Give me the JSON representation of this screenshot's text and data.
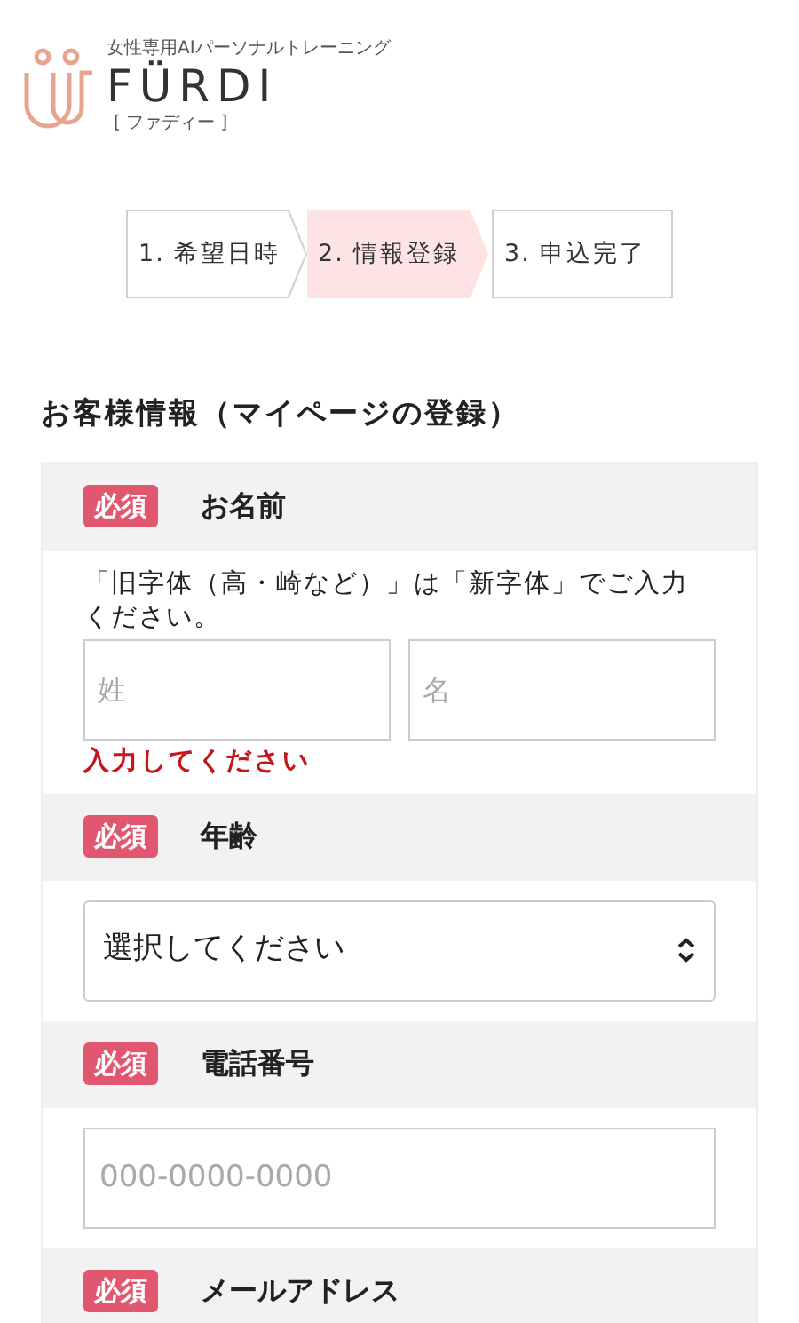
{
  "logo": {
    "tagline": "女性専用AIパーソナルトレーニング",
    "name": "FÜRDI",
    "reading": "[ ファディー ]"
  },
  "steps": [
    {
      "label": "1. 希望日時",
      "selected": false
    },
    {
      "label": "2. 情報登録",
      "selected": true
    },
    {
      "label": "3. 申込完了",
      "selected": false
    }
  ],
  "section_title": "お客様情報（マイページの登録）",
  "fields": [
    {
      "kind": "name",
      "badge": "必須",
      "label": "お名前",
      "note": "「旧字体（高・崎など）」は「新字体」でご入力ください。",
      "inputs": [
        {
          "placeholder": "姓"
        },
        {
          "placeholder": "名"
        }
      ],
      "error": "入力してください"
    },
    {
      "kind": "select",
      "badge": "必須",
      "label": "年齢",
      "value": "選択してください"
    },
    {
      "kind": "text",
      "badge": "必須",
      "label": "電話番号",
      "placeholder": "000-0000-0000"
    },
    {
      "kind": "header",
      "badge": "必須",
      "label": "メールアドレス"
    }
  ]
}
